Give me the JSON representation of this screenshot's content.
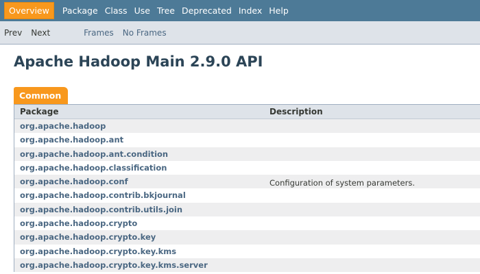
{
  "topnav": {
    "items": [
      "Overview",
      "Package",
      "Class",
      "Use",
      "Tree",
      "Deprecated",
      "Index",
      "Help"
    ]
  },
  "subnav": {
    "prev": "Prev",
    "next": "Next",
    "frames": "Frames",
    "no_frames": "No Frames"
  },
  "page_title": "Apache Hadoop Main 2.9.0 API",
  "tab_label": "Common",
  "table": {
    "headers": [
      "Package",
      "Description"
    ],
    "rows": [
      {
        "package": "org.apache.hadoop",
        "description": ""
      },
      {
        "package": "org.apache.hadoop.ant",
        "description": ""
      },
      {
        "package": "org.apache.hadoop.ant.condition",
        "description": ""
      },
      {
        "package": "org.apache.hadoop.classification",
        "description": ""
      },
      {
        "package": "org.apache.hadoop.conf",
        "description": "Configuration of system parameters."
      },
      {
        "package": "org.apache.hadoop.contrib.bkjournal",
        "description": ""
      },
      {
        "package": "org.apache.hadoop.contrib.utils.join",
        "description": ""
      },
      {
        "package": "org.apache.hadoop.crypto",
        "description": ""
      },
      {
        "package": "org.apache.hadoop.crypto.key",
        "description": ""
      },
      {
        "package": "org.apache.hadoop.crypto.key.kms",
        "description": ""
      },
      {
        "package": "org.apache.hadoop.crypto.key.kms.server",
        "description": ""
      }
    ]
  },
  "colors": {
    "nav_bg": "#4d7a97",
    "nav_active": "#f8981d",
    "subnav_bg": "#dee3e9",
    "link": "#4a6782",
    "title": "#2c4557"
  }
}
